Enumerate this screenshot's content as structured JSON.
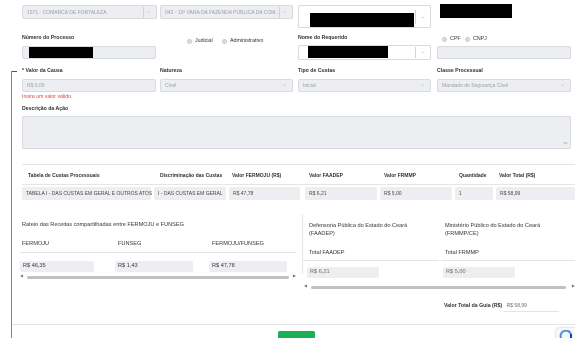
{
  "top_row": {
    "comarca_value": "1571 - COMARCA DE FORTALEZA",
    "vara_value": "042 - 10ª VARA DA FAZENDA PÚBLICA DA COM..."
  },
  "processo": {
    "label": "Número do Processo",
    "radio_judicial": "Judicial",
    "radio_administrativo": "Administrativo"
  },
  "requerido": {
    "label": "Nome do Requerido",
    "radio_cpf": "CPF",
    "radio_cnpj": "CNPJ"
  },
  "valor_causa": {
    "label": "* Valor da Causa",
    "value": "R$ 0,00",
    "error": "Insira um valor válido."
  },
  "natureza": {
    "label": "Natureza",
    "value": "Cível"
  },
  "tipo_custas": {
    "label": "Tipo de Custas",
    "value": "Inicial"
  },
  "classe_processual": {
    "label": "Classe Processual",
    "value": "Mandado de Segurança Cível"
  },
  "descricao": {
    "label": "Descrição da Ação"
  },
  "custas_table": {
    "headers": [
      "Tabela de Custas Processuais",
      "Discriminação das Custas",
      "Valor FERMOJU (R$)",
      "Valor FAADEP",
      "Valor FRMMP",
      "Quantidade",
      "Valor Total (R$)"
    ],
    "row": [
      "TABELA I - DAS CUSTAS EM GERAL E OUTROS ATOS",
      "I - DAS CUSTAS EM GERAL",
      "R$ 47,78",
      "R$ 6,21",
      "R$ 5,00",
      "1",
      "R$ 58,99"
    ]
  },
  "rateio": {
    "title": "Rateio das Receitas compartilhadas entre FERMOJU e FUNSEG",
    "headers": [
      "FERMOJU",
      "FUNSEG",
      "FERMOJU/FUNSEG"
    ],
    "values": [
      "R$ 46,35",
      "R$ 1,43",
      "R$ 47,78"
    ]
  },
  "defensoria": {
    "title": "Defensoria Pública do Estado do Ceará (FAADEP)",
    "header": "Total FAADEP",
    "value": "R$ 6,21"
  },
  "ministerio": {
    "title": "Ministério Público do Estado do Ceará (FRMMP/CE)",
    "header": "Total FRMMP",
    "value": "R$ 5,00"
  },
  "total_guia": {
    "label": "Valor Total da Guia (R$)",
    "value": "R$ 58,99"
  },
  "colors": {
    "error": "#e5413c",
    "primary_button": "#1bb055",
    "field_bg": "#eceef1"
  }
}
